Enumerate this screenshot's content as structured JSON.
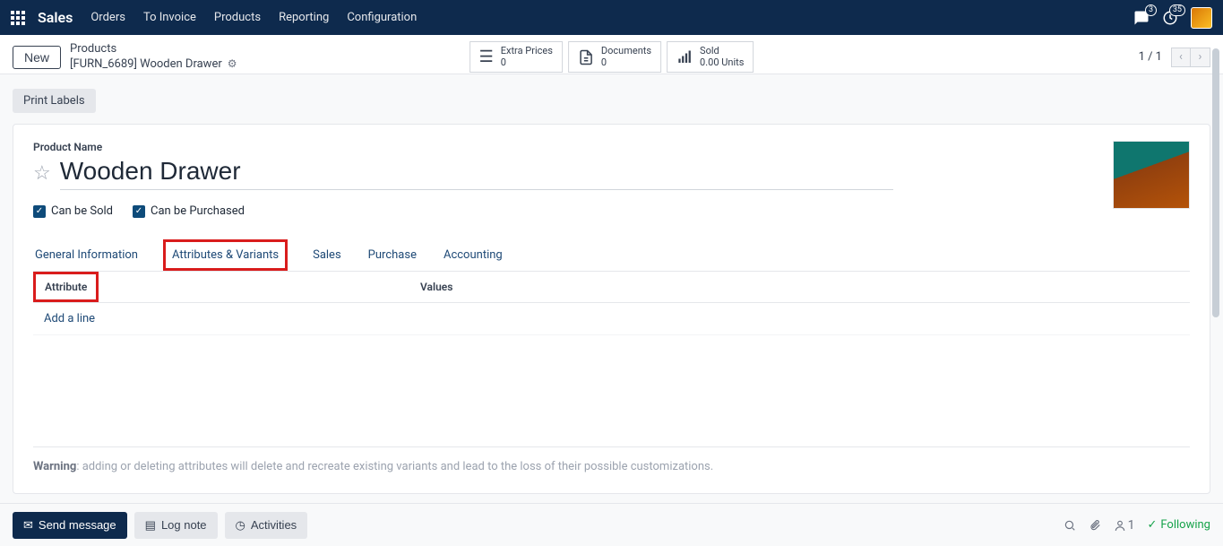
{
  "nav": {
    "brand": "Sales",
    "items": [
      "Orders",
      "To Invoice",
      "Products",
      "Reporting",
      "Configuration"
    ],
    "chat_badge": "3",
    "clock_badge": "35"
  },
  "controlbar": {
    "new_label": "New",
    "breadcrumb_top": "Products",
    "breadcrumb_current": "[FURN_6689] Wooden Drawer",
    "stats": [
      {
        "title": "Extra Prices",
        "value": "0",
        "icon": "list"
      },
      {
        "title": "Documents",
        "value": "0",
        "icon": "doc"
      },
      {
        "title": "Sold",
        "value": "0.00 Units",
        "icon": "bars"
      }
    ],
    "pager": "1 / 1"
  },
  "actions": {
    "print_labels": "Print Labels"
  },
  "product": {
    "name_label": "Product Name",
    "name": "Wooden Drawer",
    "can_sold_label": "Can be Sold",
    "can_purchased_label": "Can be Purchased",
    "tabs": [
      "General Information",
      "Attributes & Variants",
      "Sales",
      "Purchase",
      "Accounting"
    ],
    "active_tab_index": 1,
    "attr_header_1": "Attribute",
    "attr_header_2": "Values",
    "add_line": "Add a line",
    "warning_strong": "Warning",
    "warning_rest": ": adding or deleting attributes will delete and recreate existing variants and lead to the loss of their possible customizations."
  },
  "footer": {
    "send": "Send message",
    "log": "Log note",
    "activities": "Activities",
    "followers_count": "1",
    "following": "Following"
  }
}
